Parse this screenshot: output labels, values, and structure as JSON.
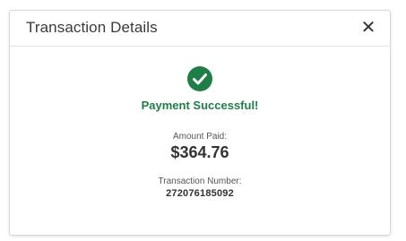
{
  "modal": {
    "title": "Transaction Details",
    "close_icon": "close-icon",
    "close_glyph": "✕"
  },
  "status": {
    "icon": "check-circle-icon",
    "icon_color": "#1f7d46",
    "message": "Payment Successful!",
    "message_color": "#1f7d46"
  },
  "amount": {
    "label": "Amount Paid:",
    "value": "$364.76"
  },
  "transaction": {
    "label": "Transaction Number:",
    "value": "272076185092"
  }
}
